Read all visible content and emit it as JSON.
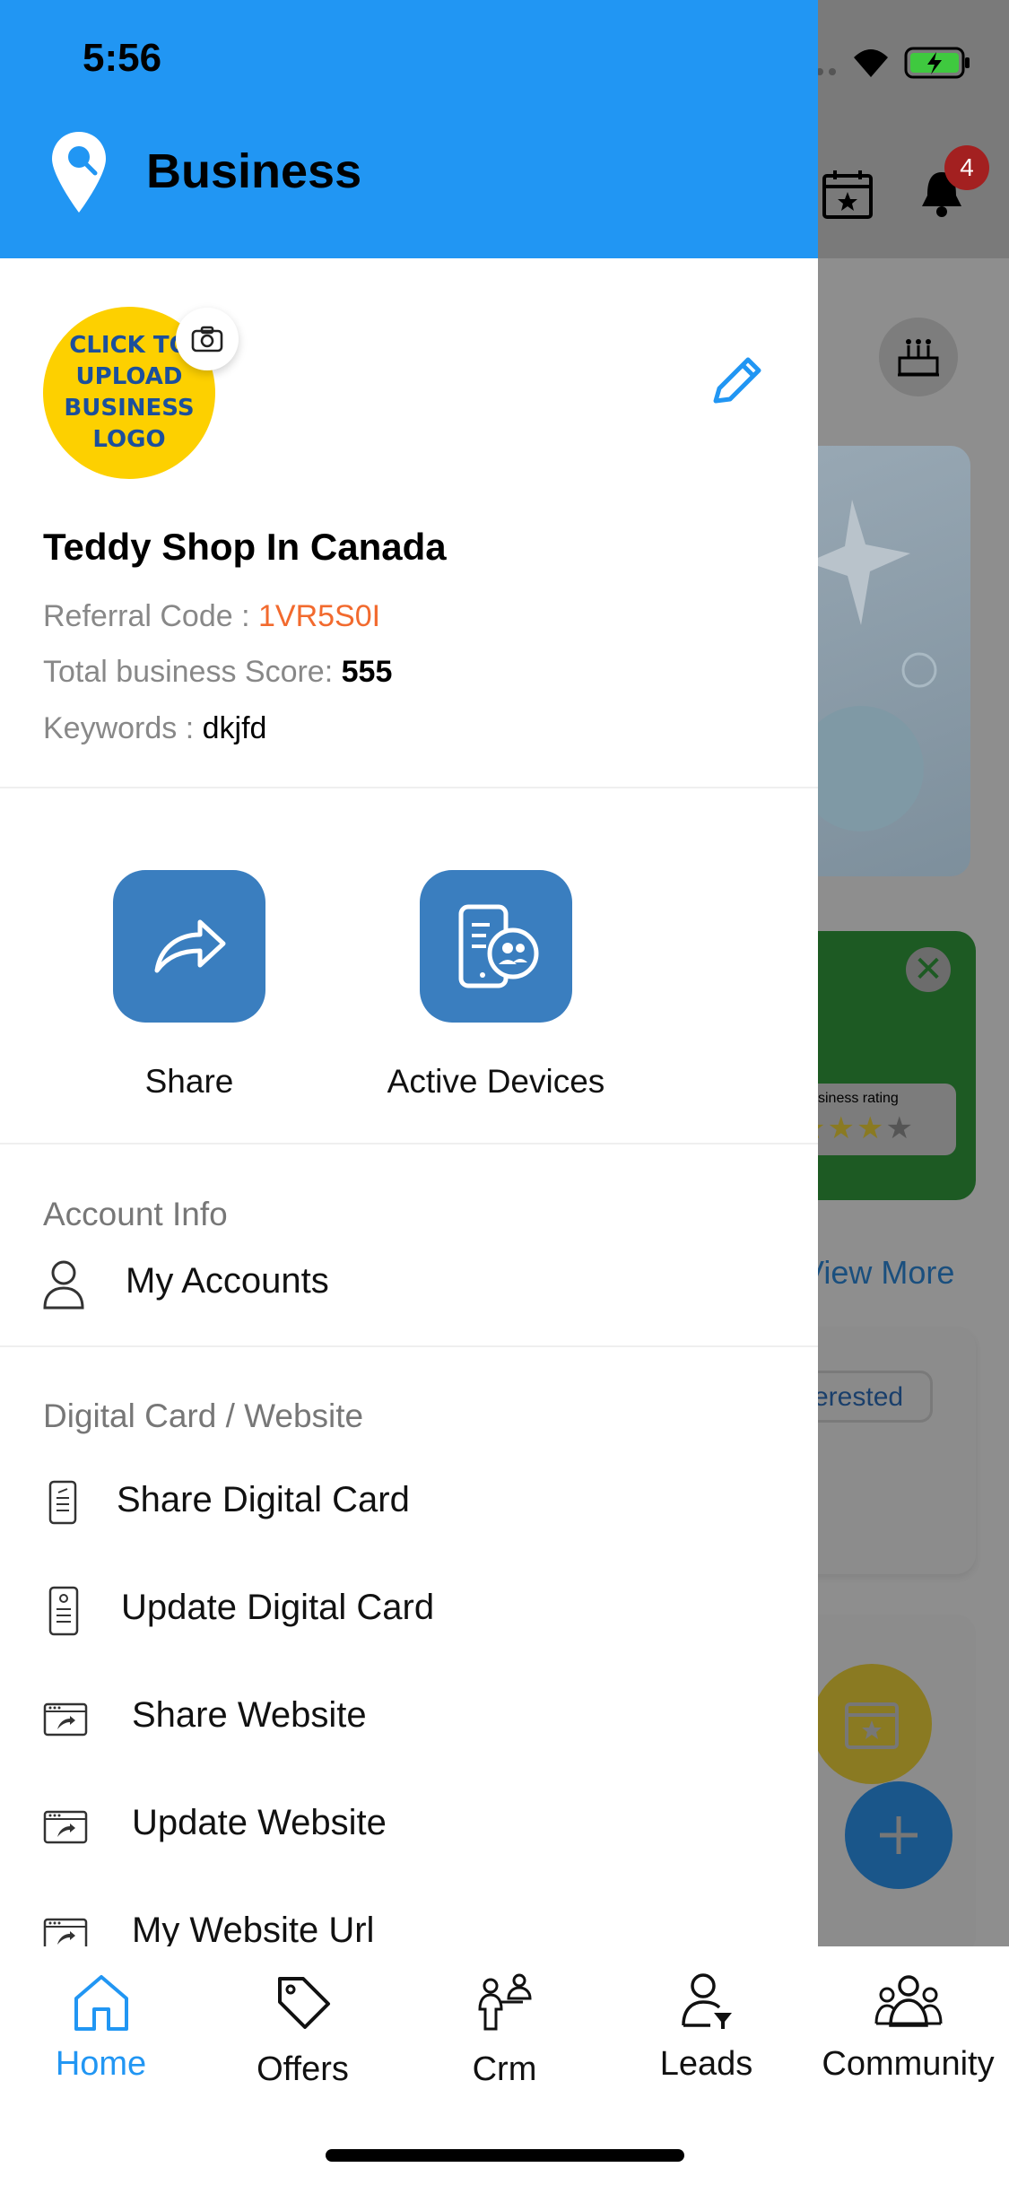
{
  "status_bar": {
    "time": "5:56"
  },
  "drawer": {
    "title": "Business",
    "logo_placeholder": "CLICK TO UPLOAD BUSINESS LOGO",
    "business_name": "Teddy Shop In Canada",
    "referral_label": "Referral Code : ",
    "referral_code": "1VR5S0I",
    "score_label": "Total business Score: ",
    "score_value": "555",
    "keywords_label": "Keywords : ",
    "keywords_value": "dkjfd",
    "quick_actions": [
      {
        "label": "Share",
        "icon": "share-arrow-icon"
      },
      {
        "label": "Active Devices",
        "icon": "devices-icon"
      }
    ],
    "account_section": {
      "title": "Account Info",
      "items": [
        {
          "label": "My Accounts",
          "icon": "person-icon"
        }
      ]
    },
    "digital_section": {
      "title": "Digital Card / Website",
      "items": [
        {
          "label": "Share Digital Card",
          "icon": "card-share-icon"
        },
        {
          "label": "Update Digital Card",
          "icon": "card-update-icon"
        },
        {
          "label": "Share Website",
          "icon": "website-share-icon"
        },
        {
          "label": "Update Website",
          "icon": "website-update-icon"
        },
        {
          "label": "My Website Url",
          "icon": "website-url-icon"
        }
      ]
    }
  },
  "background": {
    "notification_count": "4",
    "view_more": "View More",
    "interested_chip": "erested",
    "rating_text": "siness rating"
  },
  "bottom_nav": {
    "items": [
      {
        "label": "Home",
        "icon": "home-icon",
        "active": true
      },
      {
        "label": "Offers",
        "icon": "tag-icon",
        "active": false
      },
      {
        "label": "Crm",
        "icon": "crm-people-icon",
        "active": false
      },
      {
        "label": "Leads",
        "icon": "lead-filter-icon",
        "active": false
      },
      {
        "label": "Community",
        "icon": "community-icon",
        "active": false
      }
    ]
  },
  "colors": {
    "primary": "#2196f3",
    "accent_orange": "#f26a2e",
    "button_blue": "#3a7ebf",
    "logo_yellow": "#fdd000"
  }
}
